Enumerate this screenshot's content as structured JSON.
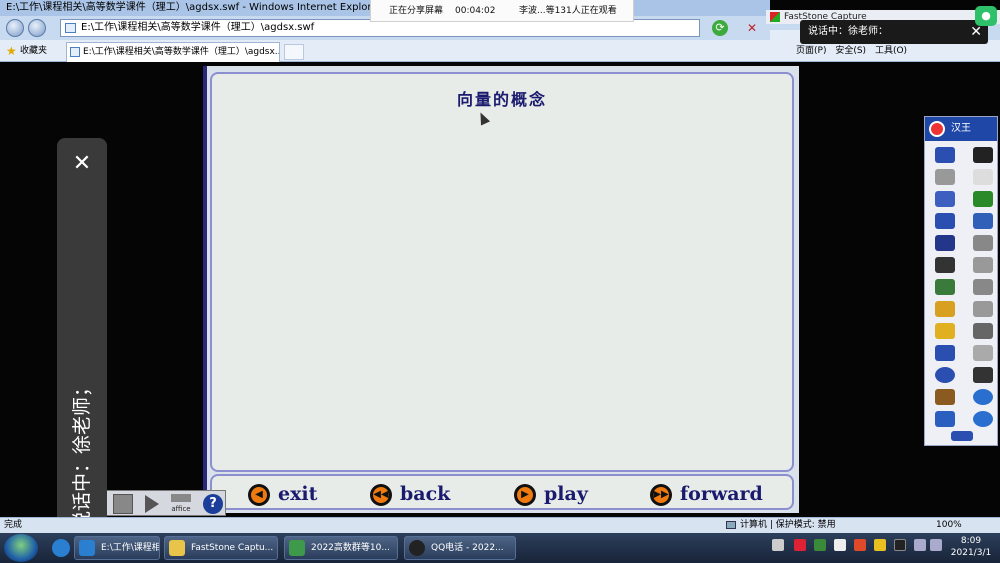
{
  "window": {
    "title": "E:\\工作\\课程相关\\高等数学课件（理工）\\agdsx.swf - Windows Internet Explorer",
    "address": "E:\\工作\\课程相关\\高等数学课件（理工）\\agdsx.swf"
  },
  "tabs": {
    "favorites_label": "收藏夹",
    "active_tab": "E:\\工作\\课程相关\\高等数学课件（理工）\\agdsx....",
    "page_menu": "页面(P)",
    "safety_menu": "安全(S)",
    "tools_menu": "工具(O)"
  },
  "share": {
    "status": "正在分享屏幕",
    "timer": "00:04:02",
    "viewers": "李波...等131人正在观看"
  },
  "popup": {
    "app": "FastStone Capture",
    "speaking": "说话中：徐老师：",
    "close": "✕"
  },
  "call": {
    "close": "✕",
    "speaking": "说话中：徐老师；"
  },
  "slide": {
    "title": "向量的概念"
  },
  "nav": {
    "exit": "exit",
    "back": "back",
    "play": "play",
    "forward": "forward",
    "exit_glyph": "◀",
    "back_glyph": "◀◀",
    "play_glyph": "▶",
    "forward_glyph": "▶▶"
  },
  "flash_toolbar": {
    "affice_label": "affice",
    "help_glyph": "?"
  },
  "draw_toolbar": {
    "brand": "汉王"
  },
  "status": {
    "left": "完成",
    "zone": "计算机 | 保护模式: 禁用",
    "zoom": "100%"
  },
  "taskbar": {
    "items": [
      {
        "label": "E:\\工作\\课程相关..."
      },
      {
        "label": "FastStone Captu..."
      },
      {
        "label": "2022高数群等10..."
      },
      {
        "label": "QQ电话 - 2022..."
      }
    ],
    "time": "8:09",
    "date": "2021/3/1"
  },
  "colors": {
    "slide_title": "#1a1a6e",
    "nav_button_orange": "#ee7a10",
    "slide_border": "#8b8fd0",
    "taskbar": "#1e2c44",
    "share_accent": "#2fc06a"
  }
}
